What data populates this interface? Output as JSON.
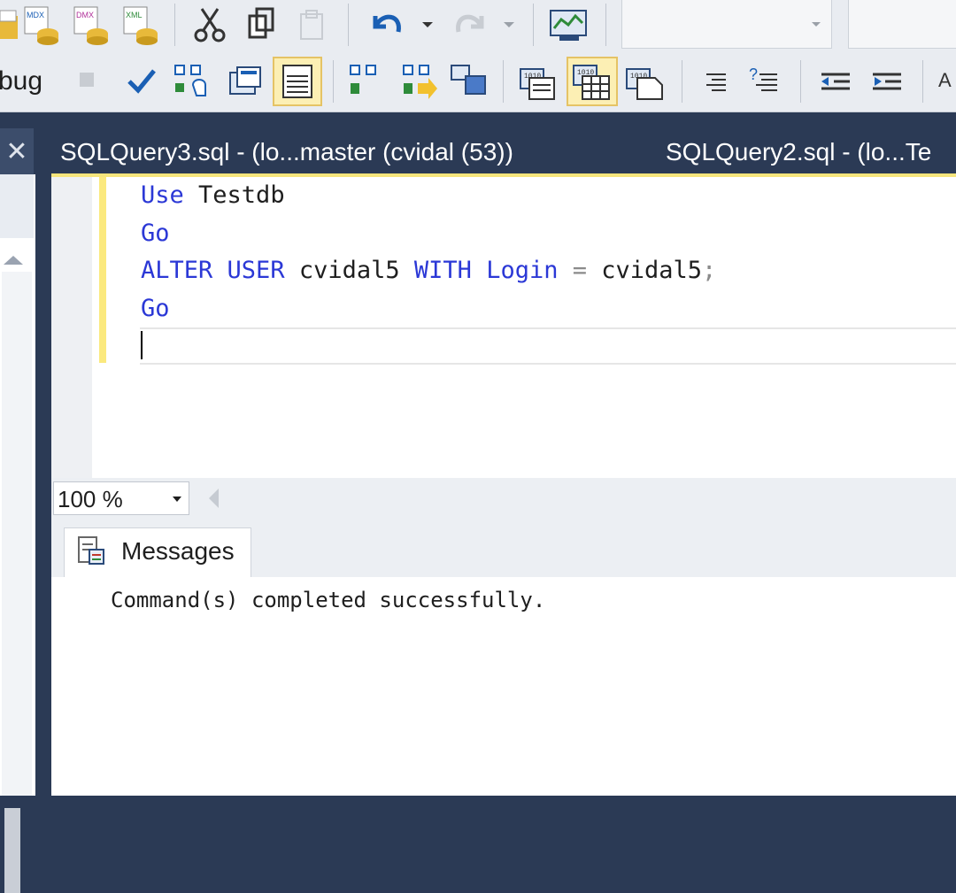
{
  "window": {
    "toolbar2_label": "bug",
    "zoom_value": "100 %"
  },
  "toolbar1": {
    "icons": [
      "mdx-query-icon",
      "dmx-query-icon",
      "xmla-query-icon",
      "cut-icon",
      "copy-icon",
      "paste-icon",
      "undo-icon",
      "redo-icon",
      "activity-monitor-icon"
    ]
  },
  "toolbar2": {
    "icons": [
      "stop-icon",
      "parse-icon",
      "estimated-plan-icon",
      "query-options-icon",
      "results-to-text-icon",
      "include-plan-icon",
      "live-stats-icon",
      "client-stats-icon",
      "results-to-text-2-icon",
      "results-to-grid-icon",
      "results-to-file-icon",
      "comment-icon",
      "uncomment-icon",
      "decrease-indent-icon",
      "increase-indent-icon"
    ]
  },
  "tabs": {
    "active": "SQLQuery3.sql - (lo...master (cvidal (53))",
    "inactive": "SQLQuery2.sql - (lo...Te"
  },
  "left_panel": {
    "close_glyph": "✕"
  },
  "editor": {
    "lines": [
      [
        {
          "t": "Use",
          "c": "kw"
        },
        {
          "t": " Testdb",
          "c": "id"
        }
      ],
      [
        {
          "t": "Go",
          "c": "kw"
        }
      ],
      [
        {
          "t": "ALTER",
          "c": "kw"
        },
        {
          "t": " ",
          "c": "id"
        },
        {
          "t": "USER",
          "c": "kw"
        },
        {
          "t": " cvidal5 ",
          "c": "id"
        },
        {
          "t": "WITH",
          "c": "kw"
        },
        {
          "t": " ",
          "c": "id"
        },
        {
          "t": "Login",
          "c": "kw"
        },
        {
          "t": " ",
          "c": "id"
        },
        {
          "t": "=",
          "c": "op"
        },
        {
          "t": " cvidal5",
          "c": "id"
        },
        {
          "t": ";",
          "c": "op"
        }
      ],
      [
        {
          "t": "Go",
          "c": "kw"
        }
      ],
      []
    ]
  },
  "results": {
    "tab_label": "Messages",
    "message": "Command(s) completed successfully."
  },
  "colors": {
    "keyword": "#2b38d6",
    "tab_strip": "#2b3a55",
    "tab_accent": "#f6e57c"
  }
}
